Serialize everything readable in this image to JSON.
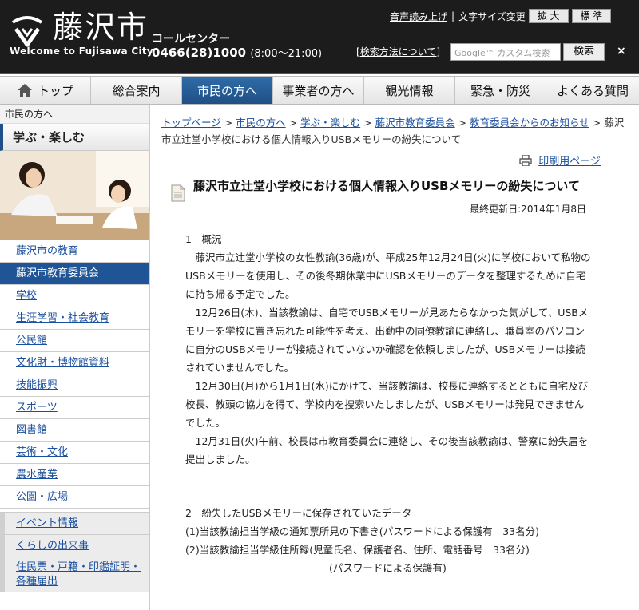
{
  "header": {
    "city_name": "藤沢市",
    "welcome": "Welcome to Fujisawa City",
    "call_center_label": "コールセンター",
    "call_center_phone": "0466(28)1000",
    "call_center_hours": "(8:00～21:00)",
    "read_aloud": "音声読み上げ",
    "font_size_label": "文字サイズ変更",
    "font_enlarge": "拡 大",
    "font_standard": "標 準",
    "search_how": "[検索方法について]",
    "search_placeholder": "Google™ カスタム検索",
    "search_button": "検索",
    "close": "×"
  },
  "nav": {
    "items": [
      "トップ",
      "総合案内",
      "市民の方へ",
      "事業者の方へ",
      "観光情報",
      "緊急・防災",
      "よくある質問"
    ],
    "active_index": 2
  },
  "sidebar": {
    "top_label": "市民の方へ",
    "section_head": "学ぶ・楽しむ",
    "items": [
      "藤沢市の教育",
      "藤沢市教育委員会",
      "学校",
      "生涯学習・社会教育",
      "公民館",
      "文化財・博物館資料",
      "技能振興",
      "スポーツ",
      "図書館",
      "芸術・文化",
      "農水産業",
      "公園・広場"
    ],
    "active_index": 1,
    "group_items": [
      "イベント情報",
      "くらしの出来事",
      "住民票・戸籍・印鑑証明・各種届出"
    ]
  },
  "breadcrumb": {
    "links": [
      "トップページ",
      "市民の方へ",
      "学ぶ・楽しむ",
      "藤沢市教育委員会",
      "教育委員会からのお知らせ"
    ],
    "separator": " > ",
    "current": "藤沢市立辻堂小学校における個人情報入りUSBメモリーの紛失について"
  },
  "print_label": "印刷用ページ",
  "page_title": "藤沢市立辻堂小学校における個人情報入りUSBメモリーの紛失について",
  "updated": "最終更新日:2014年1月8日",
  "content": {
    "s1_heading": "1　概況",
    "s1_p1": "藤沢市立辻堂小学校の女性教諭(36歳)が、平成25年12月24日(火)に学校において私物のUSBメモリーを使用し、その後冬期休業中にUSBメモリーのデータを整理するために自宅に持ち帰る予定でした。",
    "s1_p2": "12月26日(木)、当該教諭は、自宅でUSBメモリーが見あたらなかった気がして、USBメモリーを学校に置き忘れた可能性を考え、出勤中の同僚教諭に連絡し、職員室のパソコンに自分のUSBメモリーが接続されていないか確認を依頼しましたが、USBメモリーは接続されていませんでした。",
    "s1_p3": "12月30日(月)から1月1日(水)にかけて、当該教諭は、校長に連絡するとともに自宅及び校長、教頭の協力を得て、学校内を捜索いたしましたが、USBメモリーは発見できませんでした。",
    "s1_p4": "12月31日(火)午前、校長は市教育委員会に連絡し、その後当該教諭は、警察に紛失届を提出しました。",
    "s2_heading": "2　紛失したUSBメモリーに保存されていたデータ",
    "s2_l1": "(1)当該教諭担当学級の通知票所見の下書き(パスワードによる保護有　33名分)",
    "s2_l2": "(2)当該教諭担当学級住所録(児童氏名、保護者名、住所、電話番号　33名分)",
    "s2_l3": "(パスワードによる保護有)"
  }
}
